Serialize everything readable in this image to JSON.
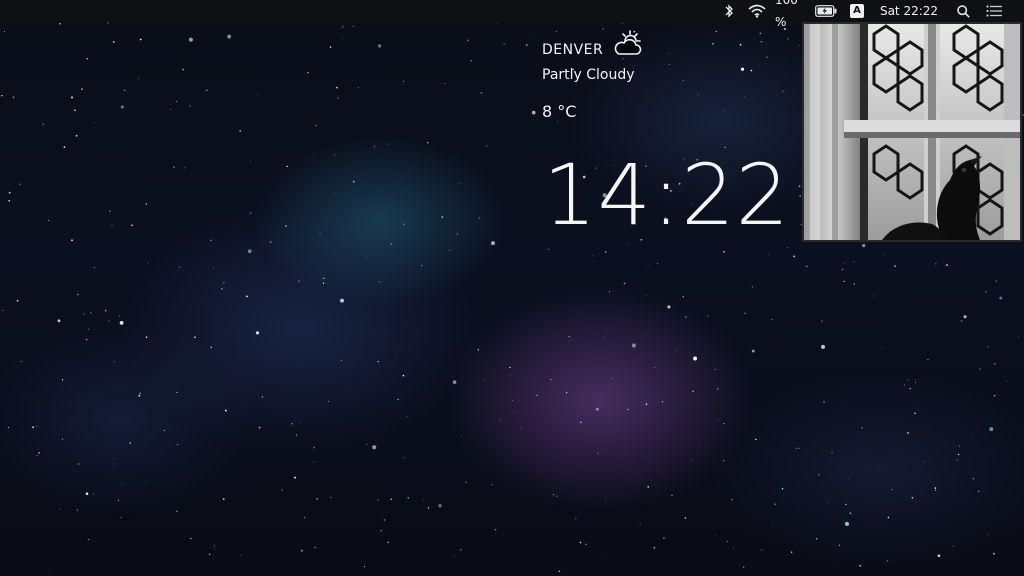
{
  "menubar": {
    "battery_percent": "100 %",
    "input_source": "A",
    "clock": "Sat 22:22",
    "icons": [
      "bluetooth-icon",
      "wifi-icon",
      "battery-icon",
      "input-source-icon",
      "spotlight-search-icon",
      "notification-center-icon"
    ]
  },
  "weather": {
    "city": "DENVER",
    "condition": "Partly Cloudy",
    "temperature": "8 °C",
    "icon": "partly-cloudy-icon"
  },
  "clock": {
    "time": "14:22"
  },
  "photo": {
    "subject": "crow-by-window-photo"
  },
  "colors": {
    "menubar_bg": "#0f1014",
    "text": "#f4f4f4",
    "nebula_purple": "#784696",
    "nebula_teal": "#286e8c"
  }
}
